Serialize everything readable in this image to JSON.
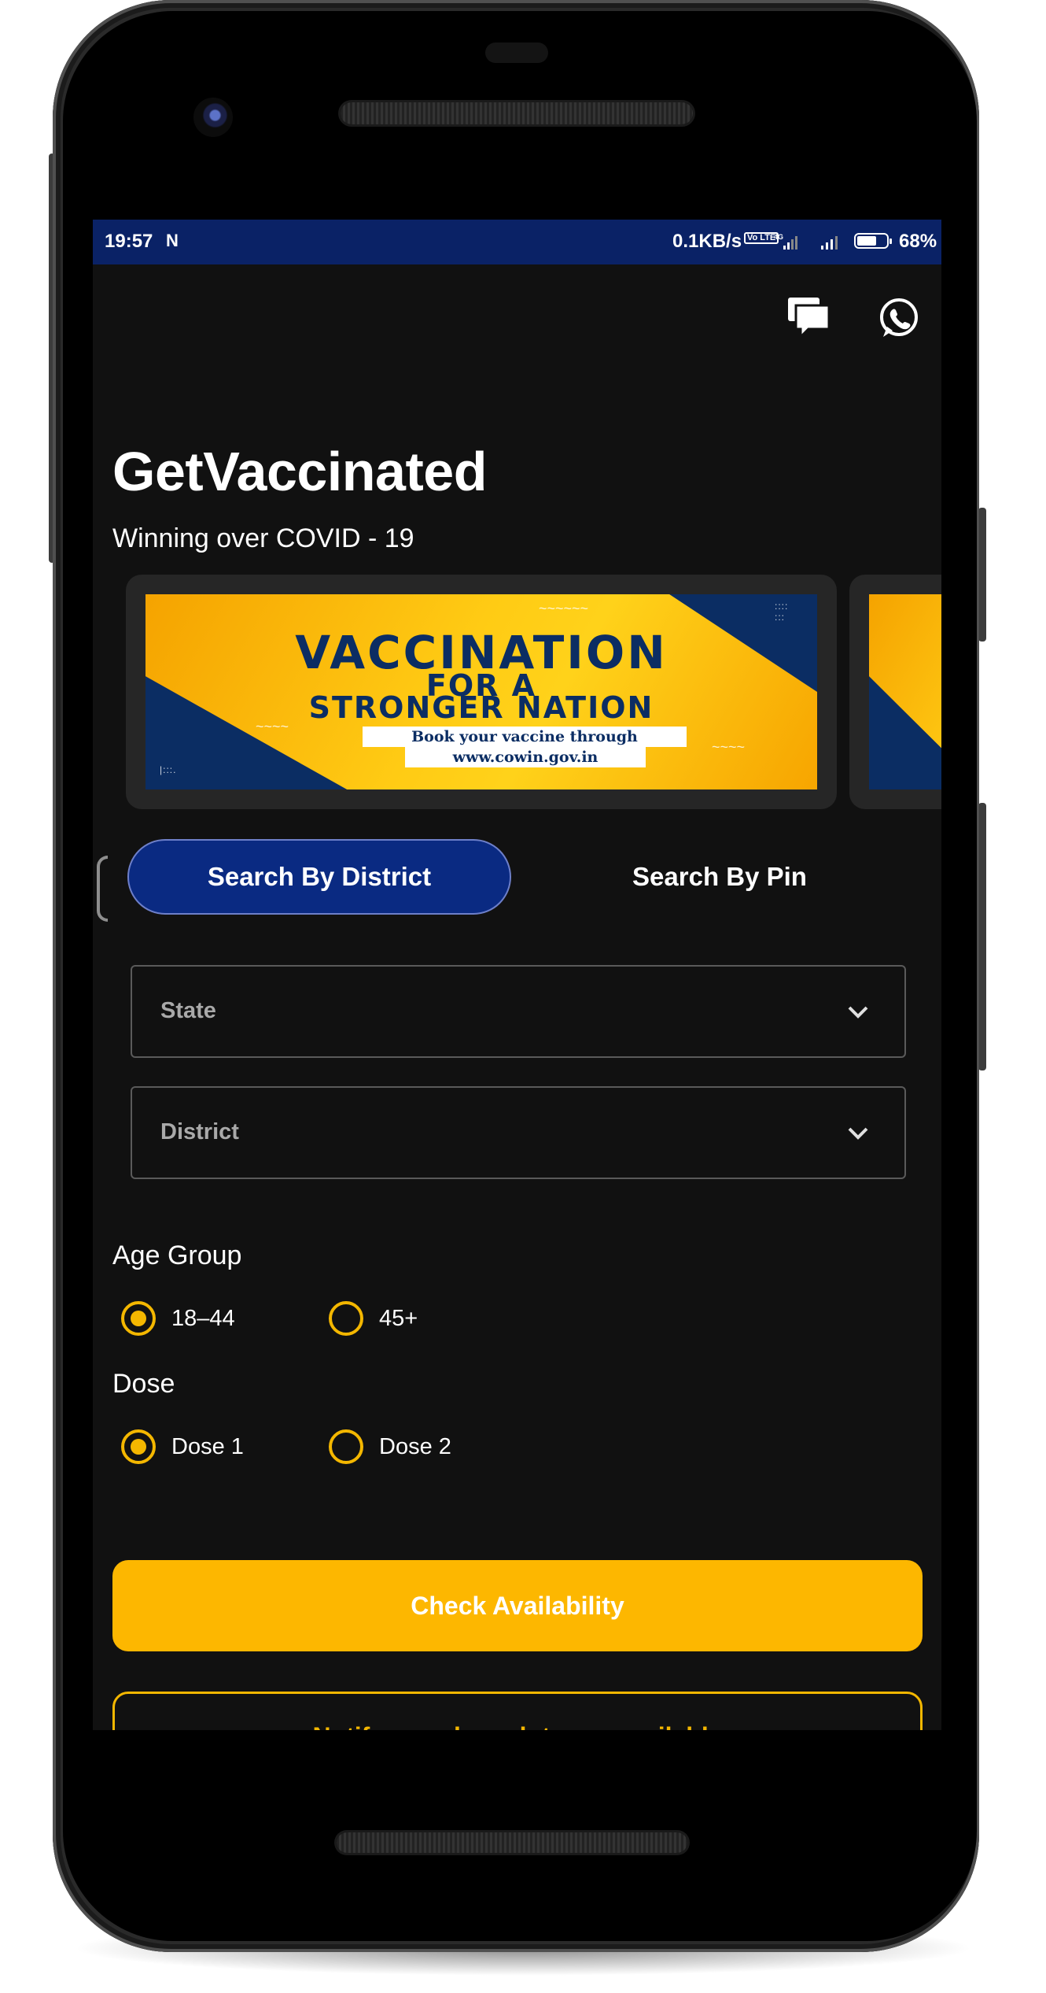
{
  "status_bar": {
    "time": "19:57",
    "notification_glyph": "N",
    "net_speed": "0.1KB/s",
    "volte": "Vo LTE",
    "network": "4G",
    "battery": "68%",
    "battery_level": 0.68,
    "background": "#0a2266"
  },
  "top_icons": [
    "chat-icon",
    "whatsapp-icon"
  ],
  "header": {
    "title": "GetVaccinated",
    "subtitle": "Winning over COVID - 19"
  },
  "banner": {
    "line1": "VACCINATION",
    "line2": "FOR A",
    "line3": "STRONGER NATION",
    "line4": "Book your vaccine through",
    "line5": "www.cowin.gov.in"
  },
  "tabs": {
    "active": "Search By District",
    "inactive": "Search By Pin"
  },
  "form": {
    "state_placeholder": "State",
    "district_placeholder": "District"
  },
  "age_group": {
    "label": "Age Group",
    "options": [
      "18–44",
      "45+"
    ],
    "selected": "18–44"
  },
  "dose": {
    "label": "Dose",
    "options": [
      "Dose 1",
      "Dose 2"
    ],
    "selected": "Dose 1"
  },
  "actions": {
    "check": "Check Availability",
    "notify": "Notify me when slots are available"
  },
  "colors": {
    "accent": "#fdb700",
    "tab_active": "#0a2a82",
    "screen_bg": "#111111"
  }
}
